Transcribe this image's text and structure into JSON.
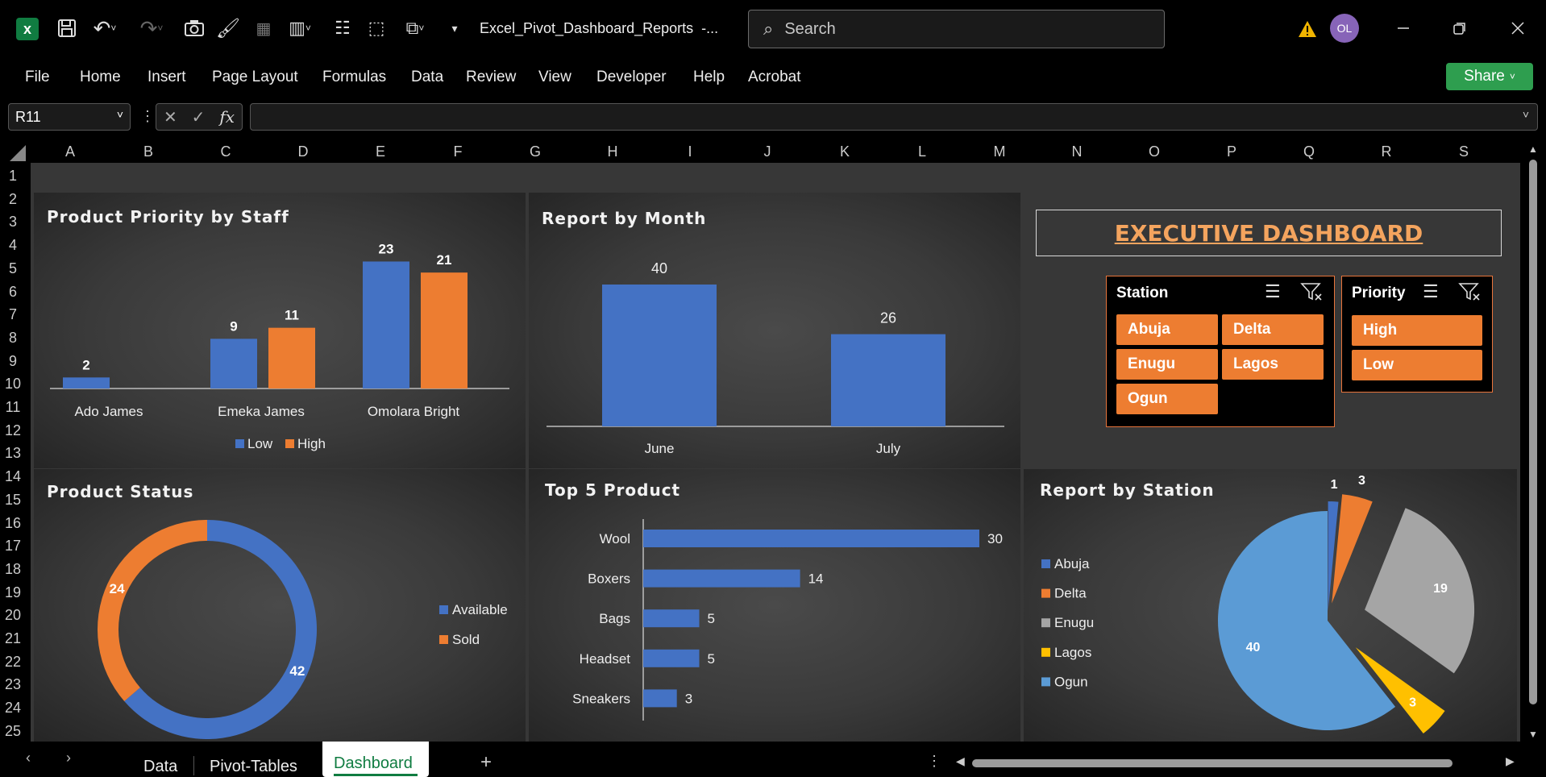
{
  "app": {
    "filename": "Excel_Pivot_Dashboard_Reports  -...",
    "search_placeholder": "Search",
    "avatar_initials": "OL",
    "share_label": "Share"
  },
  "ribbon_tabs": [
    "File",
    "Home",
    "Insert",
    "Page Layout",
    "Formulas",
    "Data",
    "Review",
    "View",
    "Developer",
    "Help",
    "Acrobat"
  ],
  "formula_bar": {
    "cell_ref": "R11",
    "formula": ""
  },
  "columns": [
    "A",
    "B",
    "C",
    "D",
    "E",
    "F",
    "G",
    "H",
    "I",
    "J",
    "K",
    "L",
    "M",
    "N",
    "O",
    "P",
    "Q",
    "R",
    "S"
  ],
  "rows": [
    "1",
    "2",
    "3",
    "4",
    "5",
    "6",
    "7",
    "8",
    "9",
    "10",
    "11",
    "12",
    "13",
    "14",
    "15",
    "16",
    "17",
    "18",
    "19",
    "20",
    "21",
    "22",
    "23",
    "24",
    "25"
  ],
  "sheet_tabs": [
    {
      "label": "Data"
    },
    {
      "label": "Pivot-Tables"
    },
    {
      "label": "Dashboard",
      "active": true
    }
  ],
  "dashboard": {
    "title": "EXECUTIVE DASHBOARD",
    "station_slicer": {
      "title": "Station",
      "items": [
        "Abuja",
        "Delta",
        "Enugu",
        "Lagos",
        "Ogun"
      ]
    },
    "priority_slicer": {
      "title": "Priority",
      "items": [
        "High",
        "Low"
      ]
    }
  },
  "chart_data": [
    {
      "id": "priority_by_staff",
      "type": "bar",
      "title": "Product Priority by Staff",
      "categories": [
        "Ado James",
        "Emeka James",
        "Omolara Bright"
      ],
      "series": [
        {
          "name": "Low",
          "values": [
            2,
            9,
            23
          ],
          "color": "#4472c4"
        },
        {
          "name": "High",
          "values": [
            null,
            11,
            21
          ],
          "color": "#ed7d31"
        }
      ],
      "legend": "bottom"
    },
    {
      "id": "report_by_month",
      "type": "bar",
      "title": "Report by Month",
      "categories": [
        "June",
        "July"
      ],
      "values": [
        40,
        26
      ],
      "color": "#4472c4"
    },
    {
      "id": "product_status",
      "type": "pie",
      "subtype": "doughnut",
      "title": "Product Status",
      "labels": [
        "Available",
        "Sold"
      ],
      "values": [
        42,
        24
      ],
      "colors": [
        "#4472c4",
        "#ed7d31"
      ],
      "legend": "right"
    },
    {
      "id": "top5_product",
      "type": "bar",
      "orientation": "horizontal",
      "title": "Top 5 Product",
      "categories": [
        "Wool",
        "Boxers",
        "Bags",
        "Headset",
        "Sneakers"
      ],
      "values": [
        30,
        14,
        5,
        5,
        3
      ],
      "color": "#4472c4"
    },
    {
      "id": "report_by_station",
      "type": "pie",
      "subtype": "exploded",
      "title": "Report by Station",
      "labels": [
        "Abuja",
        "Delta",
        "Enugu",
        "Lagos",
        "Ogun"
      ],
      "values": [
        1,
        3,
        19,
        3,
        40
      ],
      "colors": [
        "#4472c4",
        "#ed7d31",
        "#a5a5a5",
        "#ffc000",
        "#5b9bd5"
      ],
      "legend": "left"
    }
  ]
}
